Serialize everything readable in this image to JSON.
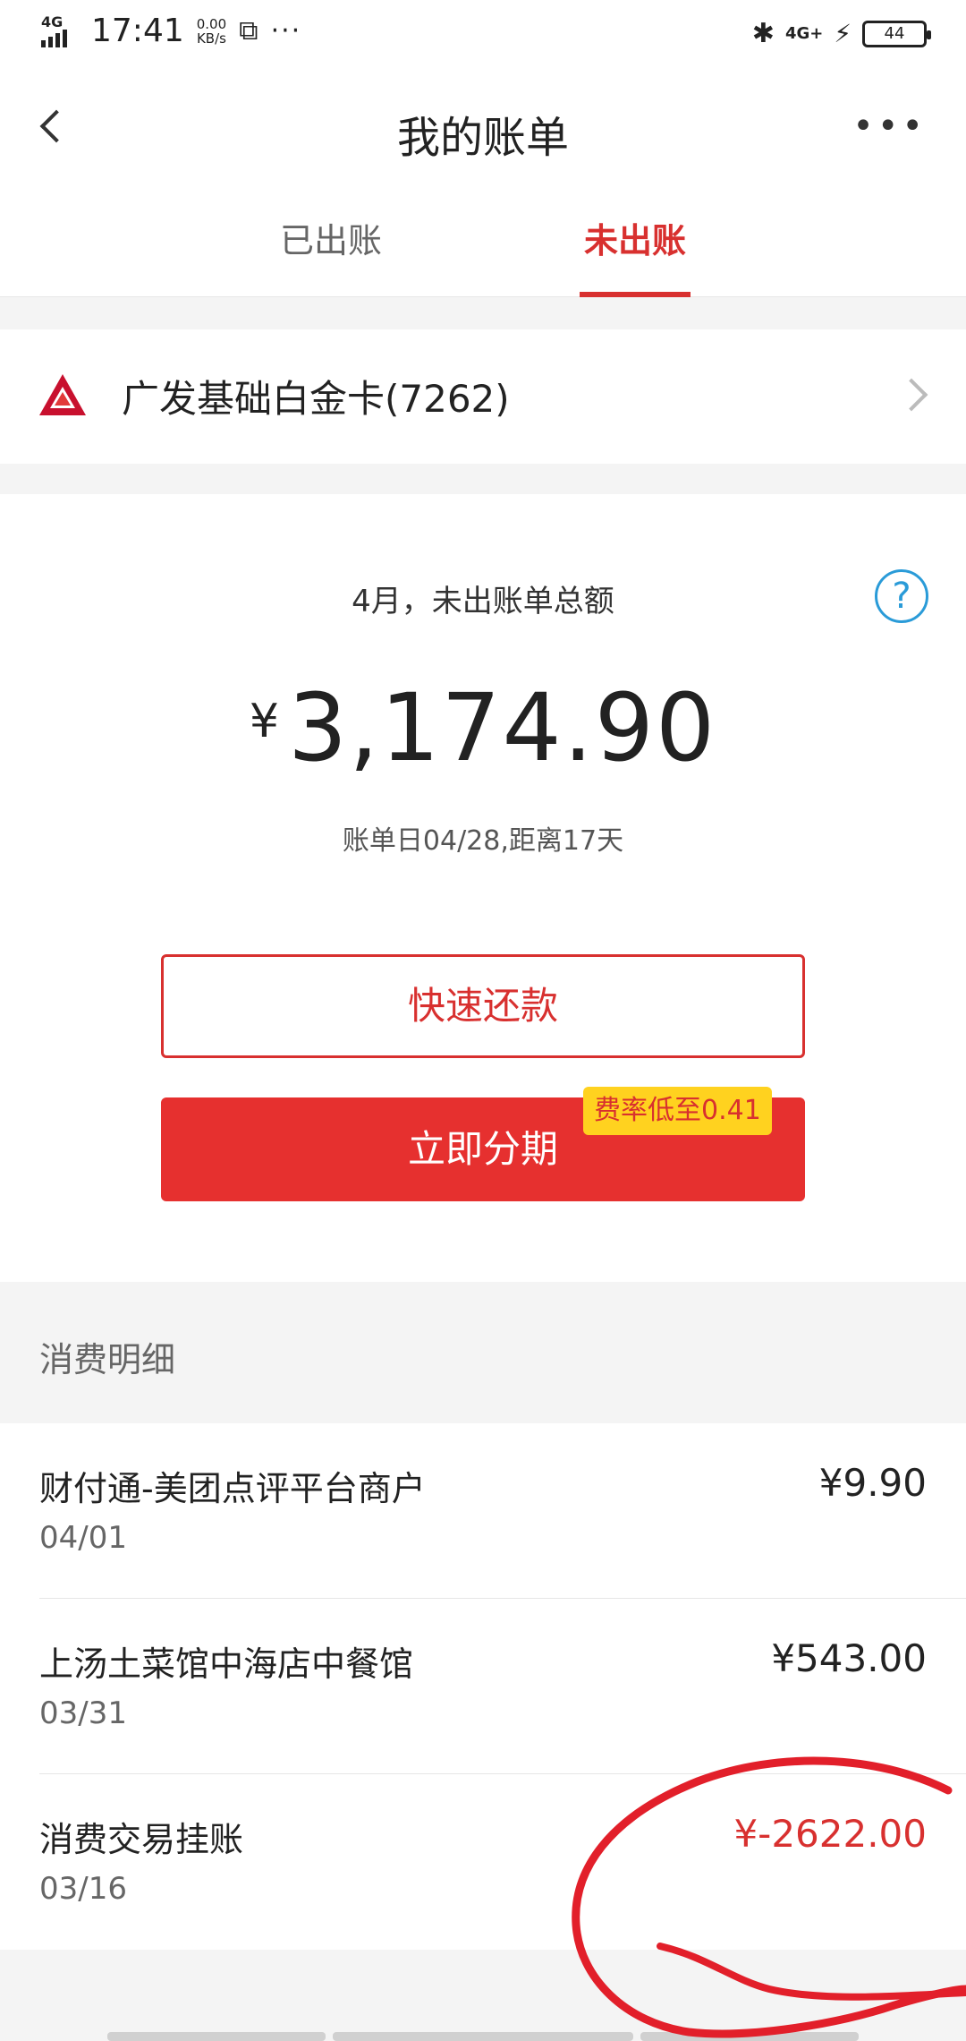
{
  "status": {
    "network_left": "4G",
    "time": "17:41",
    "speed_value": "0.00",
    "speed_unit": "KB/s",
    "network_right": "4G+",
    "battery": "44"
  },
  "header": {
    "title": "我的账单",
    "tabs": [
      {
        "label": "已出账",
        "active": false
      },
      {
        "label": "未出账",
        "active": true
      }
    ]
  },
  "card": {
    "name": "广发基础白金卡(7262)"
  },
  "summary": {
    "label": "4月，未出账单总额",
    "currency": "¥",
    "amount": "3,174.90",
    "due_text": "账单日04/28,距离17天",
    "repay_label": "快速还款",
    "installment_label": "立即分期",
    "rate_badge": "费率低至0.41"
  },
  "details": {
    "title": "消费明细",
    "transactions": [
      {
        "merchant": "财付通-美团点评平台商户",
        "date": "04/01",
        "amount": "¥9.90"
      },
      {
        "merchant": "上汤土菜馆中海店中餐馆",
        "date": "03/31",
        "amount": "¥543.00"
      },
      {
        "merchant": "消费交易挂账",
        "date": "03/16",
        "amount": "¥-2622.00"
      }
    ]
  },
  "colors": {
    "accent": "#d8302f",
    "button_red": "#e6302f",
    "badge_yellow": "#ffd21f",
    "help_blue": "#2a9bd8"
  }
}
